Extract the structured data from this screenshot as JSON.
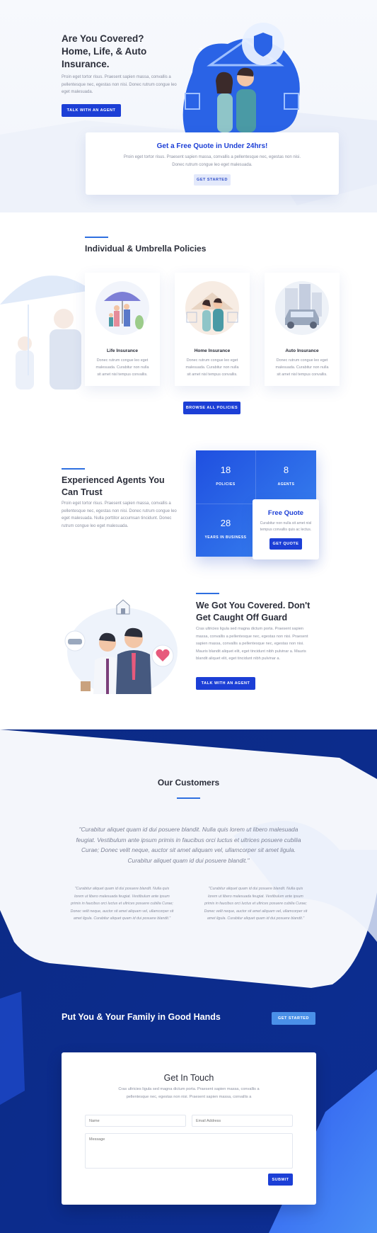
{
  "hero": {
    "title_line1": "Are You Covered?",
    "title_line2": "Home, Life, & Auto",
    "title_line3": "Insurance.",
    "text_line1": "Proin eget tortor risus. Praesent sapien massa, convallis a",
    "text_line2": "pellentesque nec, egestas non nisi. Donec rutrum congue leo",
    "text_line3": "eget malesuada.",
    "button": "Talk With An Agent"
  },
  "quote_banner": {
    "title": "Get a Free Quote in Under 24hrs!",
    "text_line1": "Proin eget tortor risus. Praesent sapien massa, convallis a pellentesque nec, egestas non nisi.",
    "text_line2": "Donec rutrum congue leo eget malesuada.",
    "button": "Get Started"
  },
  "policies": {
    "title": "Individual & Umbrella Policies",
    "cards": [
      {
        "title": "Life Insurance",
        "line1": "Donec rutrum congue leo eget",
        "line2": "malesuada. Curabitur non nulla",
        "line3": "sit amet nisl tempus convallis."
      },
      {
        "title": "Home Insurance",
        "line1": "Donec rutrum congue leo eget",
        "line2": "malesuada. Curabitur non nulla",
        "line3": "sit amet nisl tempus convallis."
      },
      {
        "title": "Auto Insurance",
        "line1": "Donec rutrum congue leo eget",
        "line2": "malesuada. Curabitur non nulla",
        "line3": "sit amet nisl tempus convallis."
      }
    ],
    "button": "Browse All Policies"
  },
  "agents": {
    "title_line1": "Experienced Agents You",
    "title_line2": "Can Trust",
    "text_line1": "Proin eget tortor risus. Praesent sapien massa, convallis a",
    "text_line2": "pellentesque nec, egestas non nisi. Donec rutrum congue leo",
    "text_line3": "eget malesuada. Nulla porttitor accumsan tincidunt. Donec",
    "text_line4": "rutrum congue leo eget malesuada.",
    "stats": [
      {
        "value": "18",
        "label": "Policies"
      },
      {
        "value": "8",
        "label": "Agents"
      },
      {
        "value": "28",
        "label": "Years in Business"
      }
    ],
    "free_quote": {
      "title": "Free Quote",
      "line1": "Curabitur non nulla sit amet nisl",
      "line2": "tempus convallis quis ac lectus.",
      "button": "Get Quote"
    }
  },
  "covered": {
    "title_line1": "We Got You Covered. Don't",
    "title_line2": "Get Caught Off Guard",
    "text_line1": "Cras ultricies ligula sed magna dictum porta. Praesent sapien",
    "text_line2": "massa, convallis a pellentesque nec, egestas non nisi. Praesent",
    "text_line3": "sapien massa, convallis a pellentesque nec, egestas non nisi.",
    "text_line4": "Mauris blandit aliquet elit, eget tincidunt nibh pulvinar a. Mauris",
    "text_line5": "blandit aliquet elit, eget tincidunt nibh pulvinar a.",
    "button": "Talk With An Agent"
  },
  "customers": {
    "title": "Our Customers",
    "main_quote_line1": "\"Curabitur aliquet quam id dui posuere blandit. Nulla quis lorem ut libero malesuada",
    "main_quote_line2": "feugiat. Vestibulum ante ipsum primis in faucibus orci luctus et ultrices posuere cubilia",
    "main_quote_line3": "Curae; Donec velit neque, auctor sit amet aliquam vel, ullamcorper sit amet ligula.",
    "main_quote_line4": "Curabitur aliquet quam id dui posuere blandit.\"",
    "small_quotes": [
      {
        "line1": "\"Curabitur aliquet quam id dui posuere blandit. Nulla quis",
        "line2": "lorem ut libero malesuada feugiat. Vestibulum ante ipsum",
        "line3": "primis in faucibus orci luctus et ultrices posuere cubilia Curae;",
        "line4": "Donec velit neque, auctor sit amet aliquam vel, ullamcorper sit",
        "line5": "amet ligula. Curabitur aliquet quam id dui posuere blandit.\""
      },
      {
        "line1": "\"Curabitur aliquet quam id dui posuere blandit. Nulla quis",
        "line2": "lorem ut libero malesuada feugiat. Vestibulum ante ipsum",
        "line3": "primis in faucibus orci luctus et ultrices posuere cubilia Curae;",
        "line4": "Donec velit neque, auctor sit amet aliquam vel, ullamcorper sit",
        "line5": "amet ligula. Curabitur aliquet quam id dui posuere blandit.\""
      }
    ]
  },
  "cta": {
    "title": "Put You & Your Family in Good Hands",
    "button": "Get Started"
  },
  "contact": {
    "title": "Get In Touch",
    "text_line1": "Cras ultricies ligula sed magna dictum porta. Praesent sapien massa, convallis a",
    "text_line2": "pellentesque nec, egestas non nisi. Praesent sapien massa, convallis a",
    "name_placeholder": "Name",
    "email_placeholder": "Email Address",
    "message_placeholder": "Message",
    "submit": "Submit"
  },
  "colors": {
    "primary": "#1c3fd6",
    "dark_blue": "#0b2a85",
    "light_blue": "#4a90e8",
    "accent_pink": "#e75a7c"
  }
}
